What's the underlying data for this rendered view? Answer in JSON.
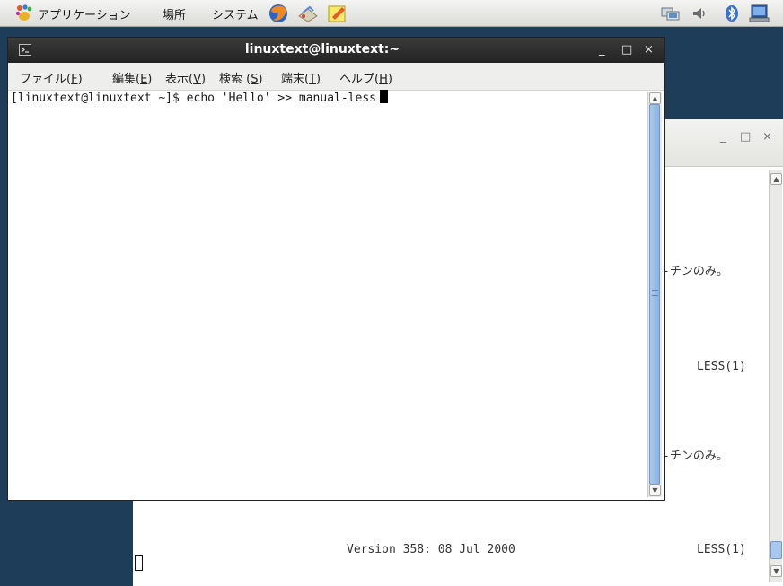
{
  "panel": {
    "menus": [
      "アプリケーション",
      "場所",
      "システム"
    ]
  },
  "background_window": {
    "lines": [
      "-チンのみ。",
      "LESS(1)",
      "-チンのみ。",
      "Version 358: 08 Jul 2000",
      "LESS(1)"
    ]
  },
  "terminal": {
    "title": "linuxtext@linuxtext:~",
    "controls": {
      "minimize": "_",
      "maximize": "□",
      "close": "×"
    },
    "menu": [
      {
        "label": "ファイル(",
        "key": "F",
        "end": ")"
      },
      {
        "label": "編集(",
        "key": "E",
        "end": ")"
      },
      {
        "label": "表示(",
        "key": "V",
        "end": ")"
      },
      {
        "label": "検索 (",
        "key": "S",
        "end": ")"
      },
      {
        "label": "端末(",
        "key": "T",
        "end": ")"
      },
      {
        "label": "ヘルプ(",
        "key": "H",
        "end": ")"
      }
    ],
    "prompt_line": "[linuxtext@linuxtext ~]$ echo 'Hello' >> manual-less"
  },
  "colors": {
    "desktop": "#1e3d58",
    "titlebar_dark": "#2a2a2a",
    "scroll_thumb": "#8db4e2"
  },
  "icons": [
    "gnome-foot-icon",
    "firefox-icon",
    "email-icon",
    "notes-icon",
    "network-icon",
    "volume-icon",
    "bluetooth-icon",
    "display-icon"
  ]
}
